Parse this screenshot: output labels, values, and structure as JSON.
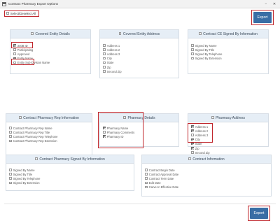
{
  "window": {
    "title": "Contract Pharmacy Export Options",
    "minimize": "−",
    "close": "✕"
  },
  "select_all_label": "Select/Deselect All",
  "export_label": "Export",
  "panels": {
    "covered_entity_details": {
      "title": "Covered Entity Details",
      "items": [
        "340B ID",
        "Participating",
        "Approved",
        "Entity Name",
        "Entity Sub-Division Name"
      ]
    },
    "covered_entity_address": {
      "title": "Covered Entity Address",
      "items": [
        "Address 1",
        "Address 2",
        "Address 3",
        "City",
        "State",
        "Zip",
        "Second Zip"
      ]
    },
    "contract_ce_signed": {
      "title": "Contract CE Signed By Information",
      "items": [
        "Signed By Name",
        "Signed By Title",
        "Signed By Telephone",
        "Signed By Extension"
      ]
    },
    "contract_pharmacy_rep": {
      "title": "Contract Pharmacy Rep Information",
      "items": [
        "Contract Pharmacy Rep Name",
        "Contract Pharmacy Rep Title",
        "Contract Pharmacy Rep Telephone",
        "Contract Pharmacy Rep Extension"
      ]
    },
    "pharmacy_details": {
      "title": "Pharmacy Details",
      "items": [
        "Pharmacy Name",
        "Pharmacy Comments",
        "Pharmacy ID"
      ]
    },
    "pharmacy_address": {
      "title": "Pharmacy Address",
      "items": [
        "Address 1",
        "Address 2",
        "Address 3",
        "City",
        "State",
        "Zip",
        "Second Zip"
      ]
    },
    "contract_pharmacy_signed": {
      "title": "Contract Pharmacy Signed By Information",
      "items": [
        "Signed By Name",
        "Signed By Title",
        "Signed By Telephone",
        "Signed By Extension"
      ]
    },
    "contract_information": {
      "title": "Contract Information",
      "items": [
        "Contract Begin Date",
        "Contract Approval Date",
        "Contract Term Date",
        "Edit Date",
        "Carve-In Effective Date"
      ]
    }
  }
}
